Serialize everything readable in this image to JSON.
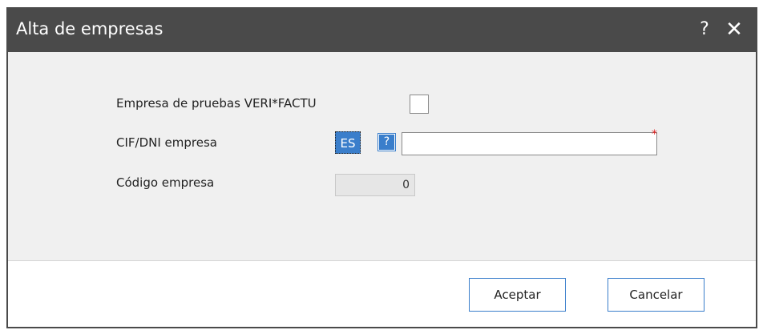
{
  "dialog": {
    "title": "Alta de empresas",
    "help_glyph": "?",
    "close_glyph": "✕"
  },
  "form": {
    "test_company_label": "Empresa de pruebas VERI*FACTU",
    "test_company_checked": false,
    "cif_label": "CIF/DNI empresa",
    "country_code": "ES",
    "country_help_glyph": "?",
    "cif_value": "",
    "required_marker": "*",
    "code_label": "Código empresa",
    "code_value": "0"
  },
  "buttons": {
    "accept": "Aceptar",
    "cancel": "Cancelar"
  },
  "colors": {
    "titlebar": "#4a4a4a",
    "accent": "#3a7ecb",
    "required": "#e02020"
  }
}
